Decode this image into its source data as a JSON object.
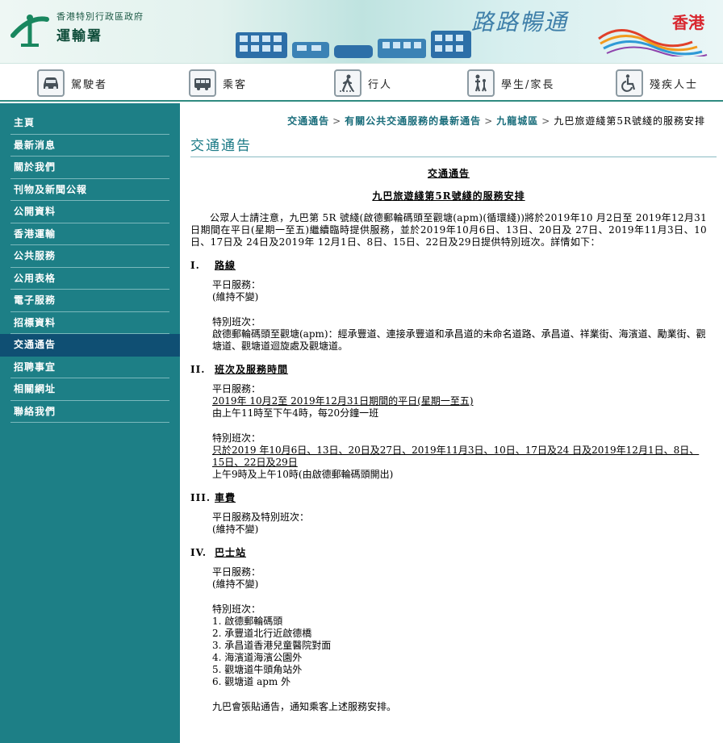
{
  "header": {
    "dept_line1": "香港特別行政區政府",
    "dept_line2": "運輸署",
    "slogan": "路路暢通",
    "brand": "香港"
  },
  "audience": [
    {
      "label": "駕駛者",
      "icon": "car-icon"
    },
    {
      "label": "乘客",
      "icon": "bus-icon"
    },
    {
      "label": "行人",
      "icon": "pedestrian-icon"
    },
    {
      "label": "學生/家長",
      "icon": "family-icon"
    },
    {
      "label": "殘疾人士",
      "icon": "wheelchair-icon"
    }
  ],
  "sidebar": {
    "items": [
      {
        "label": "主頁"
      },
      {
        "label": "最新消息"
      },
      {
        "label": "關於我們"
      },
      {
        "label": "刊物及新聞公報"
      },
      {
        "label": "公開資料"
      },
      {
        "label": "香港運輸"
      },
      {
        "label": "公共服務"
      },
      {
        "label": "公用表格"
      },
      {
        "label": "電子服務"
      },
      {
        "label": "招標資料"
      },
      {
        "label": "交通通告"
      },
      {
        "label": "招聘事宜"
      },
      {
        "label": "相關網址"
      },
      {
        "label": "聯絡我們"
      }
    ],
    "active_index": 10
  },
  "breadcrumb": {
    "links": [
      "交通通告",
      "有關公共交通服務的最新通告",
      "九龍城區"
    ],
    "separator": ">",
    "current": "九巴旅遊綫第5R號綫的服務安排"
  },
  "page_title": "交通通告",
  "notice": {
    "title": "交通通告",
    "subtitle": "九巴旅遊綫第5R號綫的服務安排",
    "intro": "公眾人士請注意，九巴第 5R 號綫(啟德郵輪碼頭至觀塘(apm)(循環綫))將於2019年10 月2日至 2019年12月31日期間在平日(星期一至五)繼續臨時提供服務，並於2019年10月6日、13日、20日及 27日、2019年11月3日、10日、17日及 24日及2019年 12月1日、8日、15日、22日及29日提供特別班次。詳情如下：",
    "sec1": {
      "num": "I.",
      "title": "路線",
      "weekday_label": "平日服務：",
      "weekday_value": "(維持不變)",
      "special_label": "特別班次：",
      "special_value": "啟德郵輪碼頭至觀塘(apm)：經承豐道、連接承豐道和承昌道的未命名道路、承昌道、祥業街、海濱道、勵業街、觀塘道、觀塘道迴旋處及觀塘道。"
    },
    "sec2": {
      "num": "II.",
      "title": "班次及服務時間",
      "weekday_label": "平日服務：",
      "weekday_period": "2019年 10月2至 2019年12月31日期間的平日(星期一至五)",
      "weekday_time": "由上午11時至下午4時，每20分鐘一班",
      "special_label": "特別班次：",
      "special_dates": "只於2019 年10月6日、13日、20日及27日、2019年11月3日、10日、17日及24 日及2019年12月1日、8日、15日、22日及29日",
      "special_time": "上午9時及上午10時(由啟德郵輪碼頭開出)"
    },
    "sec3": {
      "num": "III.",
      "title": "車費",
      "label": "平日服務及特別班次：",
      "value": "(維持不變)"
    },
    "sec4": {
      "num": "IV.",
      "title": "巴士站",
      "weekday_label": "平日服務：",
      "weekday_value": "(維持不變)",
      "special_label": "特別班次：",
      "stops": [
        "1. 啟德郵輪碼頭",
        "2. 承豐道北行近啟德橋",
        "3. 承昌道香港兒童醫院對面",
        "4. 海濱道海濱公園外",
        "5. 觀塘道牛頭角站外",
        "6. 觀塘道 apm 外"
      ]
    },
    "closing": "九巴會張貼通告，通知乘客上述服務安排。"
  }
}
